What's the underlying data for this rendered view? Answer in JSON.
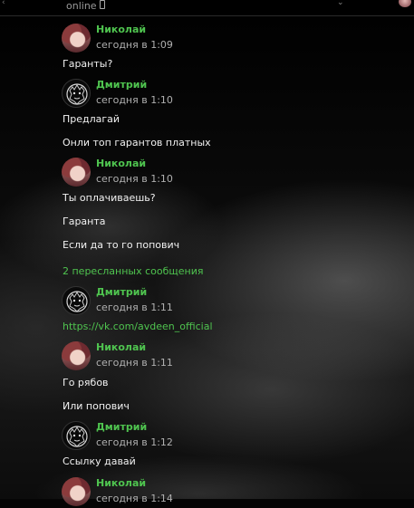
{
  "header": {
    "status": "online"
  },
  "messages": [
    {
      "author": "Николай",
      "time": "сегодня в 1:09",
      "avatar": "nikolai",
      "lines": [
        "Гаранты?"
      ]
    },
    {
      "author": "Дмитрий",
      "time": "сегодня в 1:10",
      "avatar": "dmitry",
      "lines": [
        "Предлагай",
        "Онли топ гарантов платных"
      ]
    },
    {
      "author": "Николай",
      "time": "сегодня в 1:10",
      "avatar": "nikolai",
      "lines": [
        "Ты оплачиваешь?",
        "Гаранта",
        "Если да то го попович"
      ],
      "forward_note": "2 пересланных сообщения"
    },
    {
      "author": "Дмитрий",
      "time": "сегодня в 1:11",
      "avatar": "dmitry",
      "link": "https://vk.com/avdeen_official"
    },
    {
      "author": "Николай",
      "time": "сегодня в 1:11",
      "avatar": "nikolai",
      "lines": [
        "Го рябов",
        "Или попович"
      ]
    },
    {
      "author": "Дмитрий",
      "time": "сегодня в 1:12",
      "avatar": "dmitry",
      "lines": [
        "Ссылку давай"
      ]
    },
    {
      "author": "Николай",
      "time": "сегодня в 1:14",
      "avatar": "nikolai"
    }
  ]
}
